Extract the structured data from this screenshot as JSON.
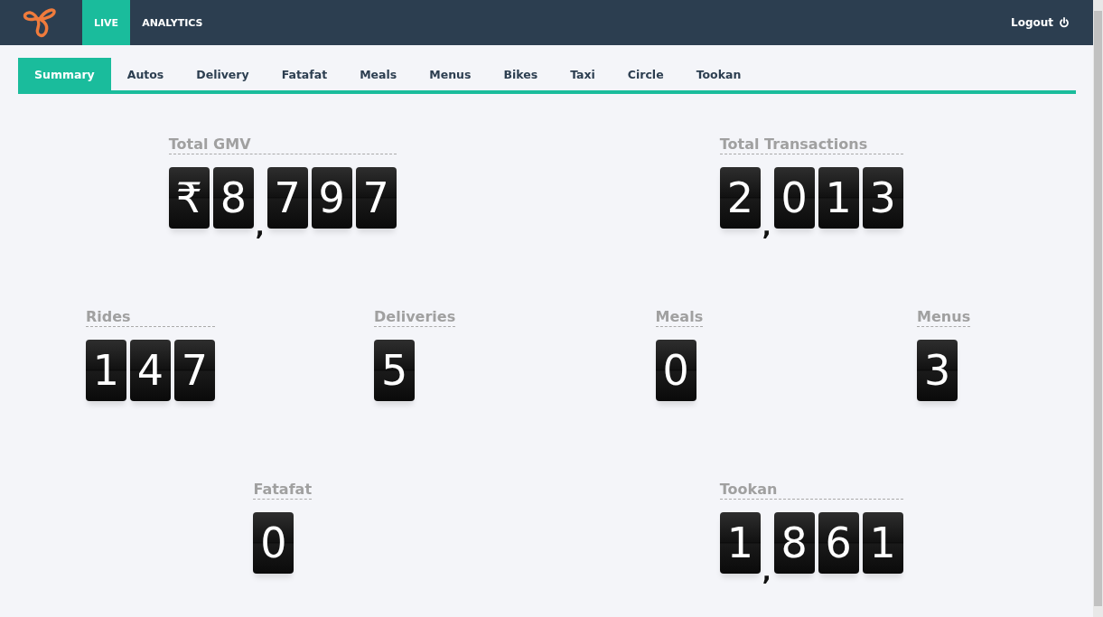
{
  "top_nav": {
    "items": [
      {
        "label": "LIVE",
        "selected": true
      },
      {
        "label": "ANALYTICS",
        "selected": false
      }
    ],
    "logout": "Logout"
  },
  "tabs": [
    {
      "label": "Summary",
      "selected": true
    },
    {
      "label": "Autos",
      "selected": false
    },
    {
      "label": "Delivery",
      "selected": false
    },
    {
      "label": "Fatafat",
      "selected": false
    },
    {
      "label": "Meals",
      "selected": false
    },
    {
      "label": "Menus",
      "selected": false
    },
    {
      "label": "Bikes",
      "selected": false
    },
    {
      "label": "Taxi",
      "selected": false
    },
    {
      "label": "Circle",
      "selected": false
    },
    {
      "label": "Tookan",
      "selected": false
    }
  ],
  "counter_rows": [
    [
      {
        "label": "Total GMV",
        "tiles": [
          "₹",
          "8",
          ",",
          "7",
          "9",
          "7"
        ]
      },
      {
        "label": "Total Transactions",
        "tiles": [
          "2",
          ",",
          "0",
          "1",
          "3"
        ]
      }
    ],
    [
      {
        "label": "Rides",
        "tiles": [
          "1",
          "4",
          "7"
        ]
      },
      {
        "label": "Deliveries",
        "tiles": [
          "5"
        ]
      },
      {
        "label": "Meals",
        "tiles": [
          "0"
        ]
      },
      {
        "label": "Menus",
        "tiles": [
          "3"
        ]
      }
    ],
    [
      {
        "label": "Fatafat",
        "tiles": [
          "0"
        ]
      },
      {
        "label": "Tookan",
        "tiles": [
          "1",
          ",",
          "8",
          "6",
          "1"
        ]
      }
    ]
  ]
}
